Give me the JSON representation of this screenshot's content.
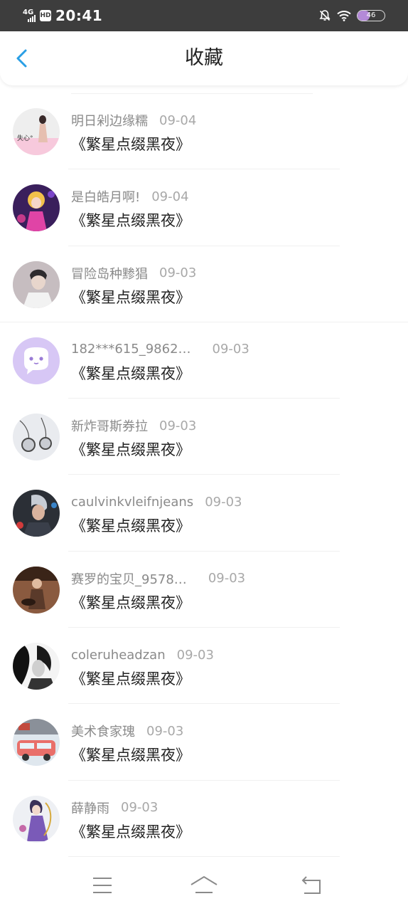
{
  "status_bar": {
    "network": "4G",
    "hd": "HD",
    "time": "20:41",
    "battery": "46",
    "icons": [
      "signal-icon",
      "hd-icon",
      "mute-bell-icon",
      "wifi-icon",
      "battery-icon"
    ]
  },
  "header": {
    "title": "收藏",
    "back_icon": "chevron-left-icon",
    "accent_color": "#2a9fe5"
  },
  "favorites": [
    {
      "name": "明日剁边缘糯",
      "date": "09-04",
      "content": "《繁星点缀黑夜》",
      "avatar_badge": "失心°"
    },
    {
      "name": "是白皓月啊!",
      "date": "09-04",
      "content": "《繁星点缀黑夜》"
    },
    {
      "name": "冒险岛种黪猖",
      "date": "09-03",
      "content": "《繁星点缀黑夜》"
    },
    {
      "name": "182***615_9862…",
      "date": "09-03",
      "content": "《繁星点缀黑夜》"
    },
    {
      "name": "新炸哥斯券拉",
      "date": "09-03",
      "content": "《繁星点缀黑夜》"
    },
    {
      "name": "caulvinkvleifnjeans",
      "date": "09-03",
      "content": "《繁星点缀黑夜》"
    },
    {
      "name": "赛罗的宝贝_9578…",
      "date": "09-03",
      "content": "《繁星点缀黑夜》"
    },
    {
      "name": "coleruheadzan",
      "date": "09-03",
      "content": "《繁星点缀黑夜》"
    },
    {
      "name": "美术食家瑰",
      "date": "09-03",
      "content": "《繁星点缀黑夜》"
    },
    {
      "name": "薛静雨",
      "date": "09-03",
      "content": "《繁星点缀黑夜》"
    }
  ],
  "nav_bar": {
    "icons": [
      "menu-icon",
      "home-icon",
      "back-icon"
    ]
  }
}
